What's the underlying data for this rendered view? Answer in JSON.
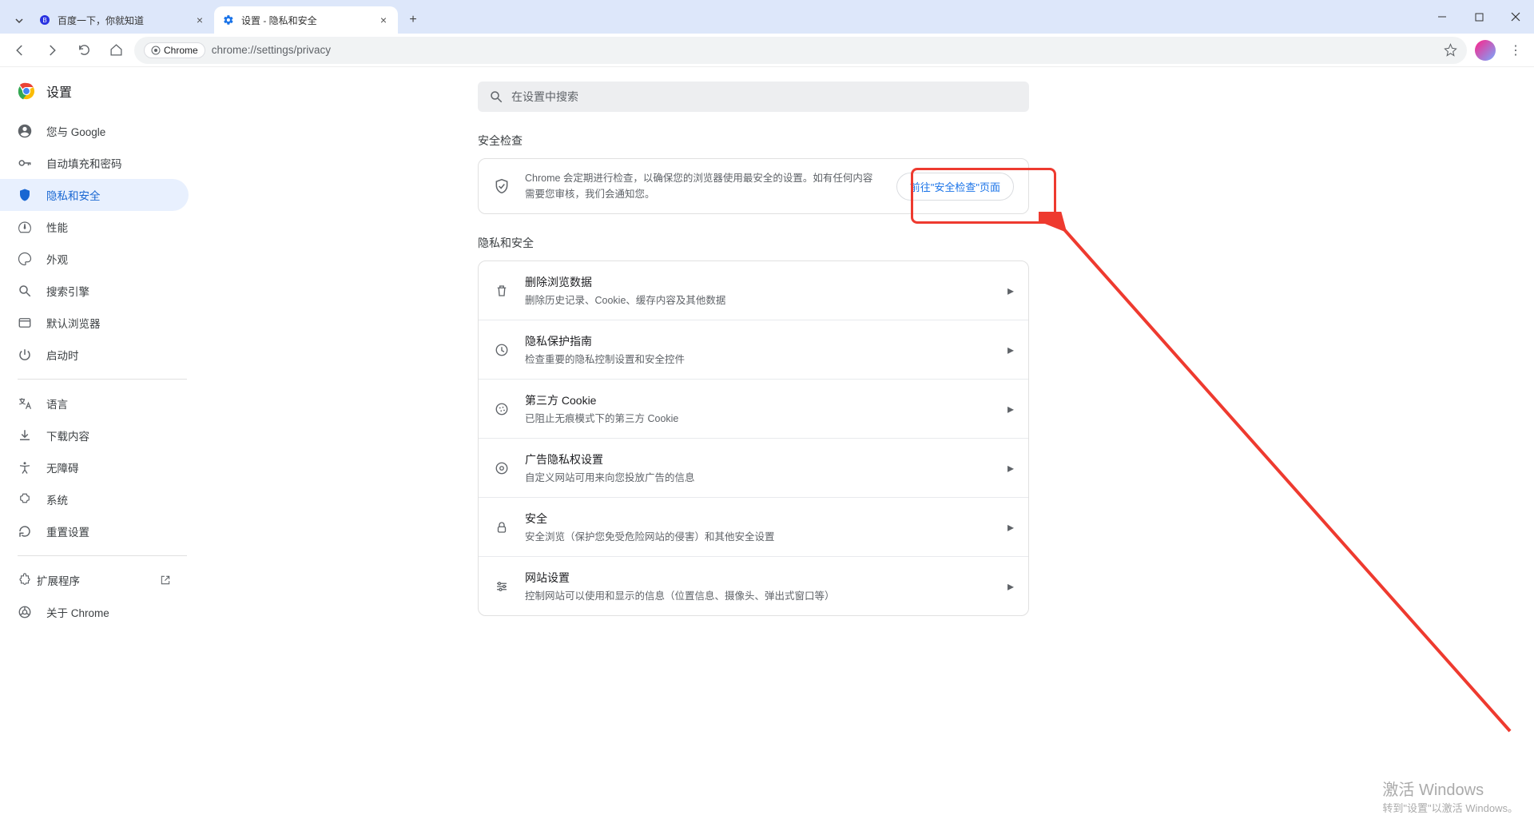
{
  "browser": {
    "tabs": [
      {
        "title": "百度一下，你就知道",
        "active": false
      },
      {
        "title": "设置 - 隐私和安全",
        "active": true
      }
    ],
    "url_chip": "Chrome",
    "url": "chrome://settings/privacy"
  },
  "settings": {
    "app_name": "设置",
    "search_placeholder": "在设置中搜索",
    "nav": [
      {
        "label": "您与 Google"
      },
      {
        "label": "自动填充和密码"
      },
      {
        "label": "隐私和安全",
        "active": true
      },
      {
        "label": "性能"
      },
      {
        "label": "外观"
      },
      {
        "label": "搜索引擎"
      },
      {
        "label": "默认浏览器"
      },
      {
        "label": "启动时"
      }
    ],
    "nav2": [
      {
        "label": "语言"
      },
      {
        "label": "下载内容"
      },
      {
        "label": "无障碍"
      },
      {
        "label": "系统"
      },
      {
        "label": "重置设置"
      }
    ],
    "nav3": [
      {
        "label": "扩展程序",
        "ext": true
      },
      {
        "label": "关于 Chrome"
      }
    ]
  },
  "sections": {
    "safety_title": "安全检查",
    "safety_text": "Chrome 会定期进行检查，以确保您的浏览器使用最安全的设置。如有任何内容需要您审核，我们会通知您。",
    "safety_button": "前往\"安全检查\"页面",
    "privacy_title": "隐私和安全",
    "rows": [
      {
        "title": "删除浏览数据",
        "sub": "删除历史记录、Cookie、缓存内容及其他数据"
      },
      {
        "title": "隐私保护指南",
        "sub": "检查重要的隐私控制设置和安全控件"
      },
      {
        "title": "第三方 Cookie",
        "sub": "已阻止无痕模式下的第三方 Cookie"
      },
      {
        "title": "广告隐私权设置",
        "sub": "自定义网站可用来向您投放广告的信息"
      },
      {
        "title": "安全",
        "sub": "安全浏览（保护您免受危险网站的侵害）和其他安全设置"
      },
      {
        "title": "网站设置",
        "sub": "控制网站可以使用和显示的信息（位置信息、摄像头、弹出式窗口等）"
      }
    ]
  },
  "watermark": {
    "l1": "激活 Windows",
    "l2": "转到\"设置\"以激活 Windows。"
  }
}
